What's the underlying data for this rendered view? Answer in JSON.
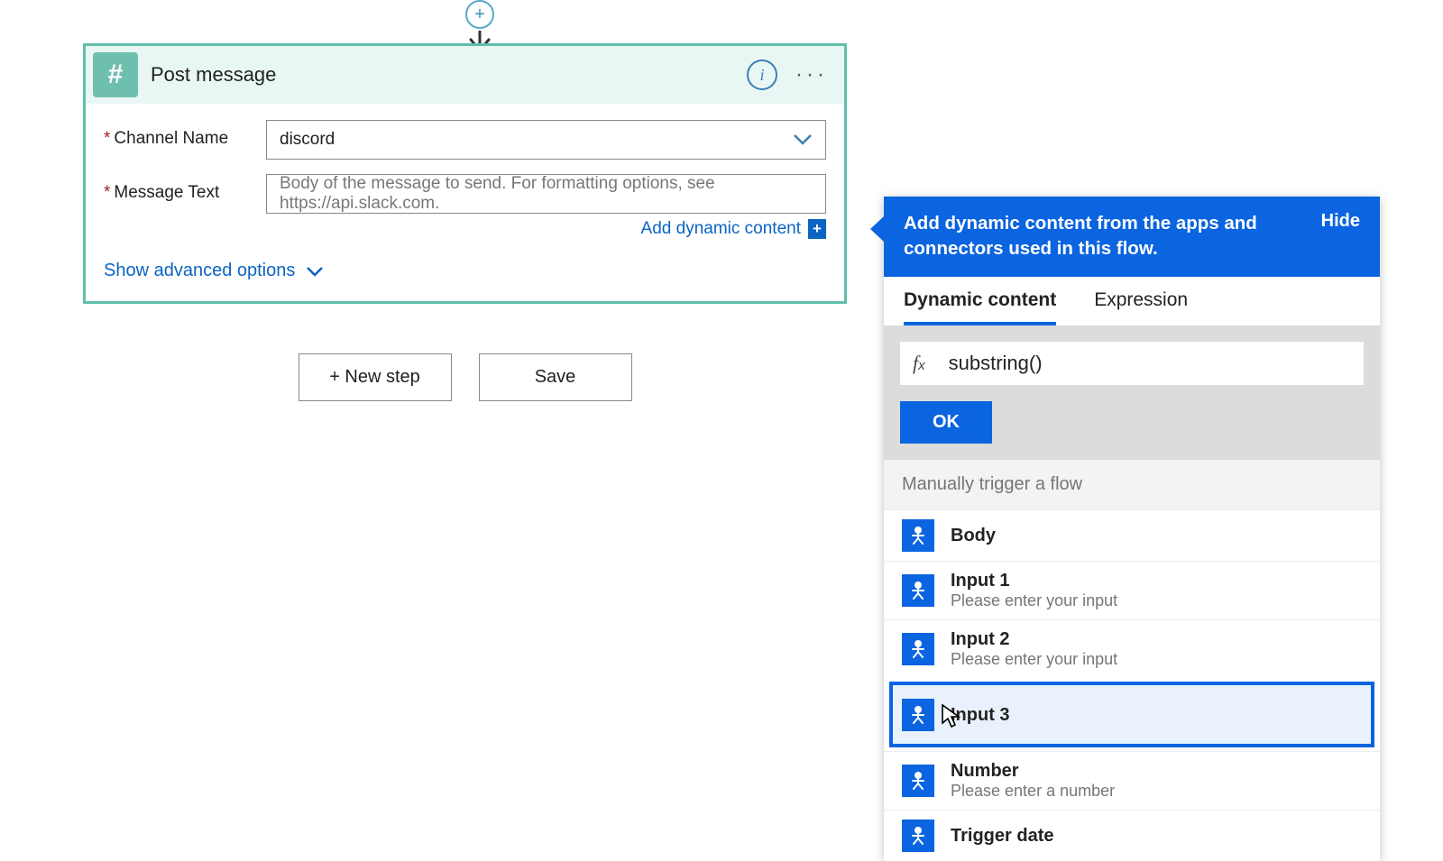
{
  "connector": {
    "plus_label": "+"
  },
  "card": {
    "icon_glyph": "#",
    "title": "Post message",
    "fields": {
      "channel": {
        "label": "Channel Name",
        "value": "discord"
      },
      "message": {
        "label": "Message Text",
        "placeholder": "Body of the message to send. For formatting options, see https://api.slack.com."
      }
    },
    "add_dynamic_label": "Add dynamic content",
    "show_advanced_label": "Show advanced options"
  },
  "buttons": {
    "new_step": "+ New step",
    "save": "Save"
  },
  "panel": {
    "header_text": "Add dynamic content from the apps and connectors used in this flow.",
    "hide_label": "Hide",
    "tabs": {
      "dynamic": "Dynamic content",
      "expression": "Expression"
    },
    "expression_value": "substring()",
    "ok_label": "OK",
    "group_title": "Manually trigger a flow",
    "items": [
      {
        "label": "Body",
        "desc": ""
      },
      {
        "label": "Input 1",
        "desc": "Please enter your input"
      },
      {
        "label": "Input 2",
        "desc": "Please enter your input"
      },
      {
        "label": "Input 3",
        "desc": ""
      },
      {
        "label": "Number",
        "desc": "Please enter a number"
      },
      {
        "label": "Trigger date",
        "desc": ""
      }
    ],
    "selected_index": 3
  }
}
